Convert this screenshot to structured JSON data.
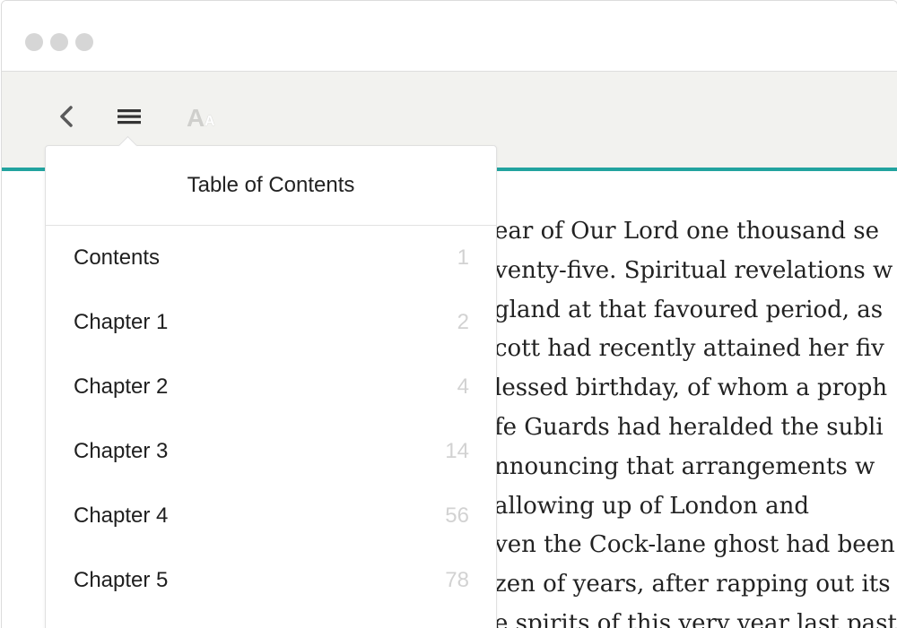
{
  "toolbar": {
    "back_icon": "chevron-left-icon",
    "menu_icon": "hamburger-menu-icon",
    "font_icon": "font-size-icon",
    "font_icon_large": "A",
    "font_icon_small": "A"
  },
  "colors": {
    "accent": "#22a39f",
    "toolbar_bg": "#f2f2ef",
    "window_dot": "#d6d6d6"
  },
  "toc": {
    "title": "Table of Contents",
    "items": [
      {
        "label": "Contents",
        "page": "1"
      },
      {
        "label": "Chapter 1",
        "page": "2"
      },
      {
        "label": "Chapter 2",
        "page": "4"
      },
      {
        "label": "Chapter 3",
        "page": "14"
      },
      {
        "label": "Chapter 4",
        "page": "56"
      },
      {
        "label": "Chapter 5",
        "page": "78"
      }
    ]
  },
  "reader": {
    "lines": [
      "ear of Our Lord one thousand se",
      "venty-five. Spiritual revelations w",
      "gland at that favoured period, as",
      "cott had recently attained her fiv",
      "lessed birthday, of whom a proph",
      "fe Guards had heralded the subli",
      "nnouncing that arrangements w",
      "allowing up of London and",
      "ven the Cock-lane ghost had been",
      "zen of years, after rapping out its",
      "e spirits of this very year last past"
    ]
  }
}
